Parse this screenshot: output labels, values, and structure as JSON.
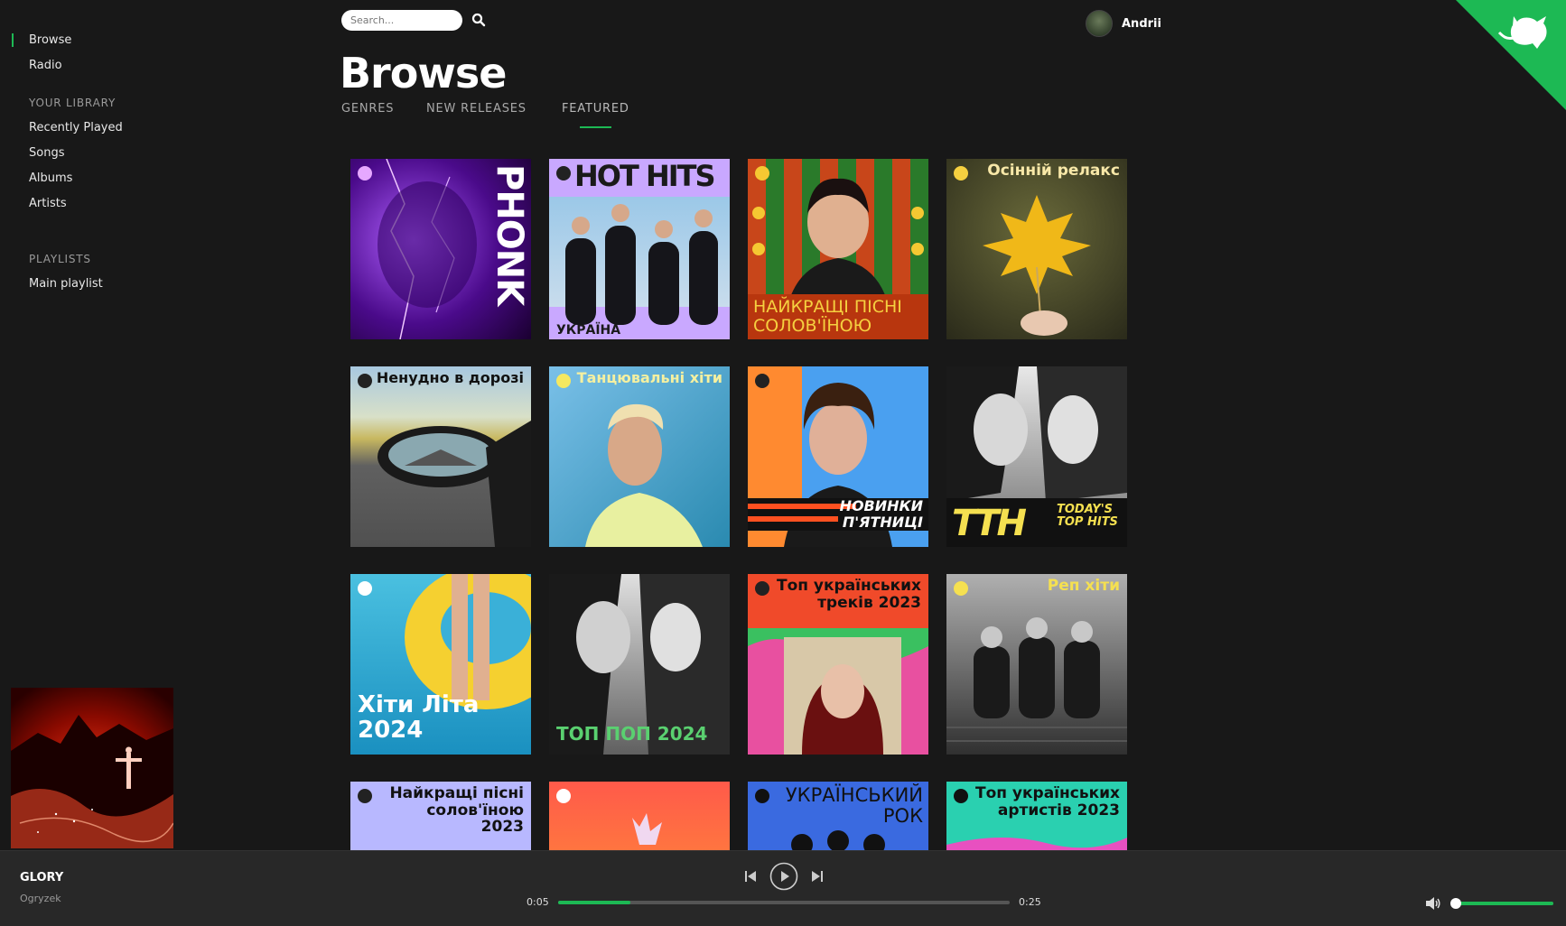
{
  "sidebar": {
    "items": [
      {
        "label": "Browse",
        "active": true
      },
      {
        "label": "Radio"
      }
    ],
    "library_label": "YOUR LIBRARY",
    "library_items": [
      {
        "label": "Recently Played"
      },
      {
        "label": "Songs"
      },
      {
        "label": "Albums"
      },
      {
        "label": "Artists"
      }
    ],
    "playlists_label": "PLAYLISTS",
    "playlists": [
      {
        "label": "Main playlist"
      }
    ]
  },
  "search": {
    "placeholder": "Search..."
  },
  "user": {
    "name": "Andrii"
  },
  "page": {
    "title": "Browse"
  },
  "tabs": [
    {
      "label": "GENRES"
    },
    {
      "label": "NEW RELEASES"
    },
    {
      "label": "FEATURED",
      "active": true
    }
  ],
  "cards": [
    {
      "title": "PHONK"
    },
    {
      "title": "HOT HITS",
      "subtitle": "УКРАЇНА"
    },
    {
      "title": "НАЙКРАЩІ ПІСНІ СОЛОВ'ЇНОЮ"
    },
    {
      "title": "Осінній релакс"
    },
    {
      "title": "Ненудно в дорозі"
    },
    {
      "title": "Танцювальні хіти"
    },
    {
      "title": "НОВИНКИ П'ЯТНИЦІ"
    },
    {
      "title": "TODAY'S TOP HITS"
    },
    {
      "title": "Хіти Літа 2024"
    },
    {
      "title": "ТОП ПОП 2024"
    },
    {
      "title": "Топ українських треків 2023"
    },
    {
      "title": "Реп хіти"
    },
    {
      "title": "Найкращі пісні солов'їною 2023"
    },
    {
      "title": ""
    },
    {
      "title": "УКРАЇНСЬКИЙ РОК"
    },
    {
      "title": "Топ українських артистів 2023"
    }
  ],
  "player": {
    "title": "GLORY",
    "artist": "Ogryzek",
    "current_time": "0:05",
    "duration": "0:25",
    "progress": 0.16,
    "volume": 0.02
  },
  "colors": {
    "accent": "#1db954",
    "background": "#181818",
    "player_bg": "#282828"
  }
}
